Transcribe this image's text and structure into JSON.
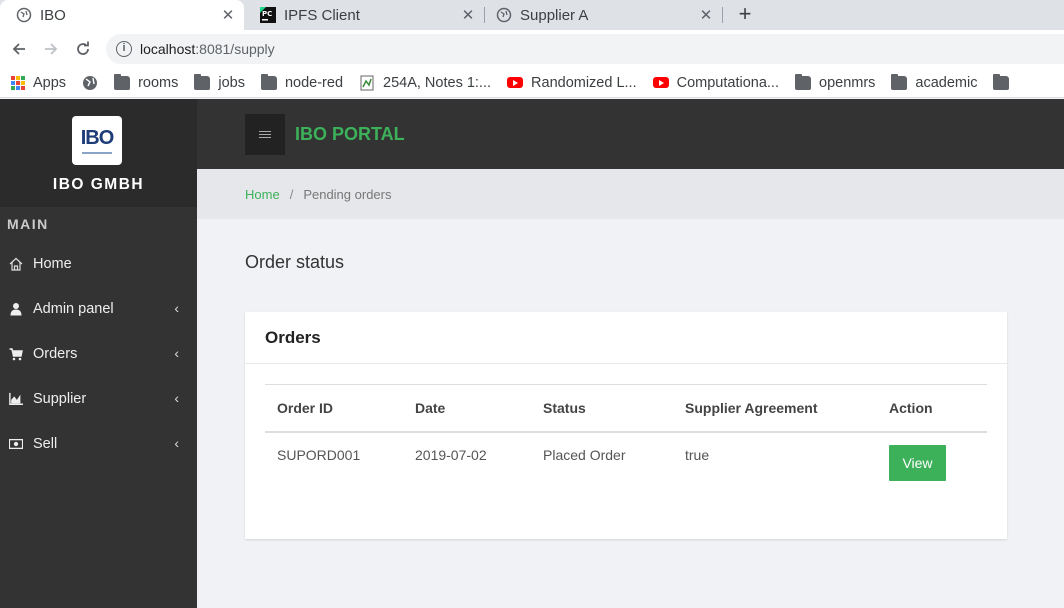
{
  "browser": {
    "tabs": [
      {
        "title": "IBO",
        "icon": "globe-icon"
      },
      {
        "title": "IPFS Client",
        "icon": "pycharm-icon"
      },
      {
        "title": "Supplier A",
        "icon": "globe-icon"
      }
    ],
    "url_host": "localhost",
    "url_rest": ":8081/supply",
    "bookmarks": [
      {
        "label": "Apps",
        "icon": "apps-grid-icon"
      },
      {
        "label": "",
        "icon": "globe-icon"
      },
      {
        "label": "rooms",
        "icon": "folder-icon"
      },
      {
        "label": "jobs",
        "icon": "folder-icon"
      },
      {
        "label": "node-red",
        "icon": "folder-icon"
      },
      {
        "label": "254A, Notes 1:...",
        "icon": "page-icon"
      },
      {
        "label": "Randomized L...",
        "icon": "youtube-icon"
      },
      {
        "label": "Computationa...",
        "icon": "youtube-icon"
      },
      {
        "label": "openmrs",
        "icon": "folder-icon"
      },
      {
        "label": "academic",
        "icon": "folder-icon"
      }
    ]
  },
  "sidebar": {
    "logo_text": "IBO",
    "brand": "IBO GMBH",
    "section": "MAIN",
    "items": [
      {
        "label": "Home",
        "icon": "home-icon",
        "chevron": false
      },
      {
        "label": "Admin panel",
        "icon": "user-icon",
        "chevron": true
      },
      {
        "label": "Orders",
        "icon": "cart-icon",
        "chevron": true
      },
      {
        "label": "Supplier",
        "icon": "chart-icon",
        "chevron": true
      },
      {
        "label": "Sell",
        "icon": "money-icon",
        "chevron": true
      }
    ]
  },
  "header": {
    "title": "IBO PORTAL",
    "accent_color": "#3cb15a"
  },
  "breadcrumb": {
    "home": "Home",
    "separator": "/",
    "current": "Pending orders"
  },
  "main": {
    "title": "Order status",
    "card_title": "Orders",
    "columns": [
      "Order ID",
      "Date",
      "Status",
      "Supplier Agreement",
      "Action"
    ],
    "rows": [
      {
        "order_id": "SUPORD001",
        "date": "2019-07-02",
        "status": "Placed Order",
        "agreement": "true",
        "action": "View"
      }
    ]
  }
}
